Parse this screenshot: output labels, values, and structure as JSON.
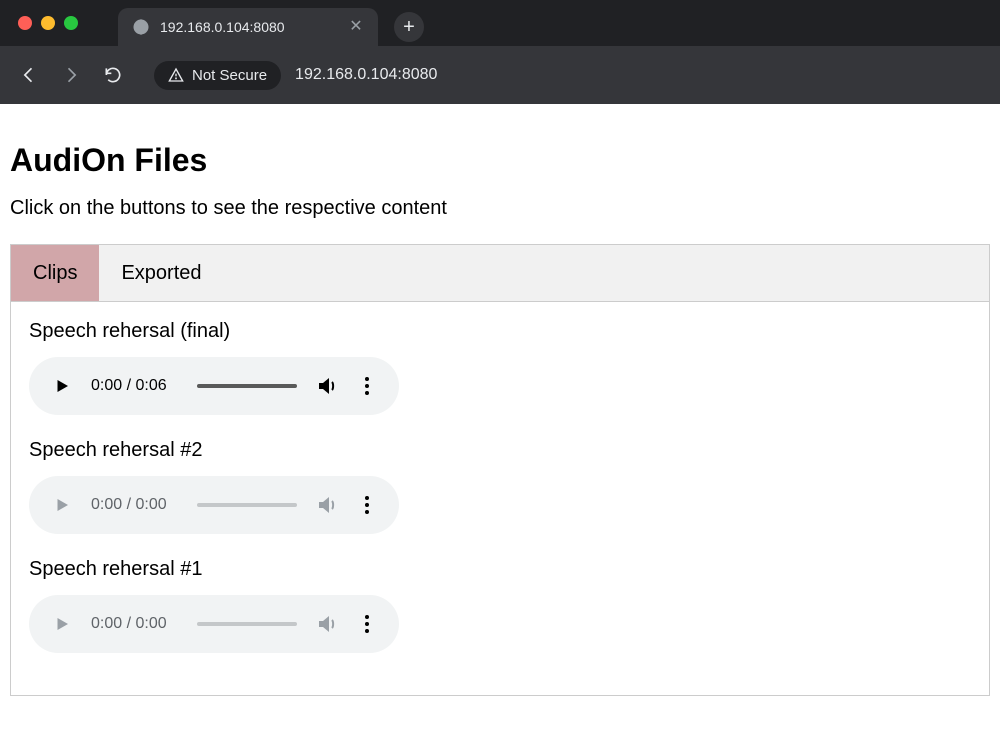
{
  "browser": {
    "tab_title": "192.168.0.104:8080",
    "security_label": "Not Secure",
    "url": "192.168.0.104:8080"
  },
  "page": {
    "title": "AudiOn Files",
    "subtitle": "Click on the buttons to see the respective content"
  },
  "tabs": [
    {
      "label": "Clips",
      "active": true
    },
    {
      "label": "Exported",
      "active": false
    }
  ],
  "clips": [
    {
      "title": "Speech rehersal (final)",
      "time": "0:00 / 0:06",
      "enabled": true
    },
    {
      "title": "Speech rehersal #2",
      "time": "0:00 / 0:00",
      "enabled": false
    },
    {
      "title": "Speech rehersal #1",
      "time": "0:00 / 0:00",
      "enabled": false
    }
  ]
}
